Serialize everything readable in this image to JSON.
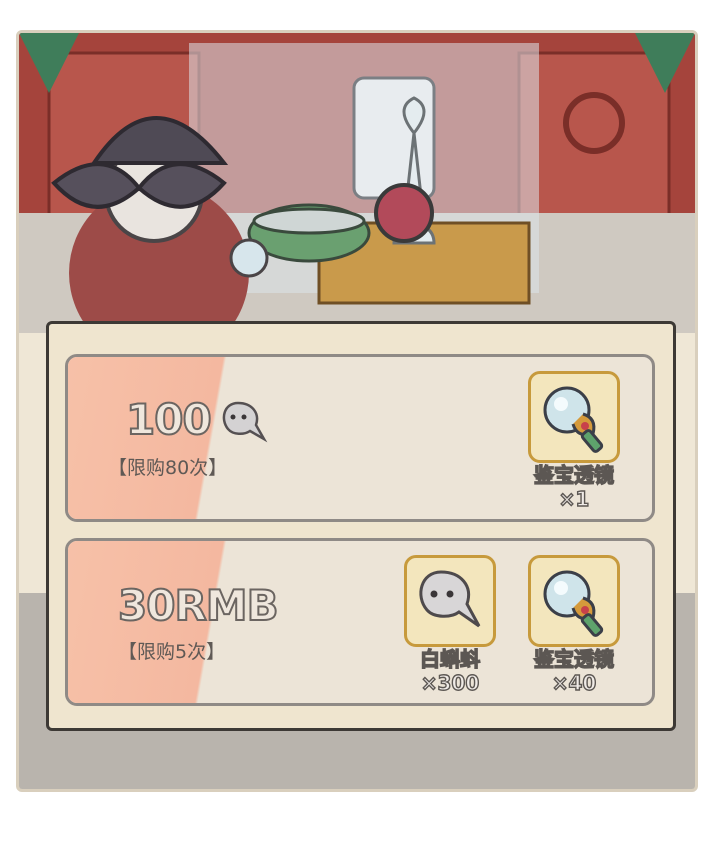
{
  "shop": {
    "items": [
      {
        "price": "100",
        "price_currency_icon": "white-tadpole-icon",
        "limit": "【限购80次】",
        "rewards": [
          {
            "name": "鉴宝透镜",
            "quantity": "×1",
            "icon": "magnifying-lens-icon"
          }
        ]
      },
      {
        "price": "30RMB",
        "limit": "【限购5次】",
        "rewards": [
          {
            "name": "白蝌蚪",
            "quantity": "×300",
            "icon": "white-tadpole-icon"
          },
          {
            "name": "鉴宝透镜",
            "quantity": "×40",
            "icon": "magnifying-lens-icon"
          }
        ]
      }
    ]
  },
  "colors": {
    "panel_border": "#3d3935",
    "row_stripe": "#f4b8a0",
    "slot_border": "#c79a3c"
  }
}
